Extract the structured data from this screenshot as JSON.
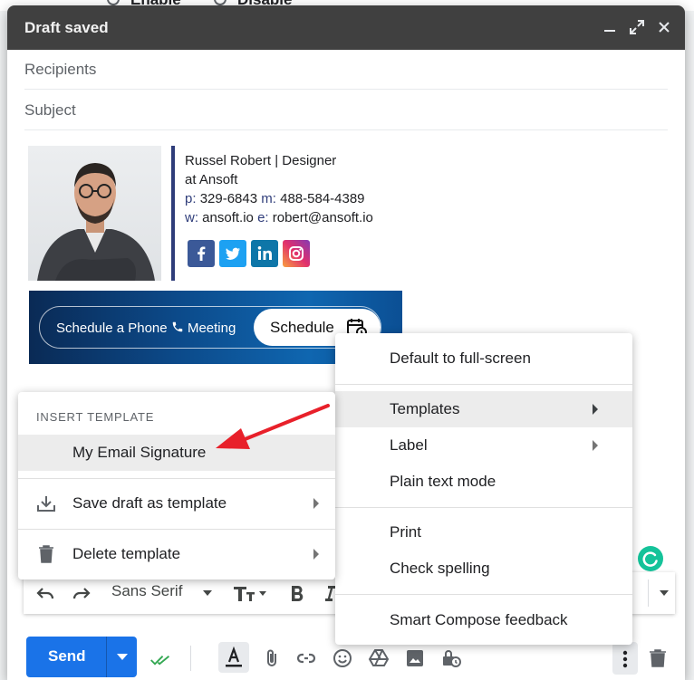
{
  "background": {
    "option_enable": "Enable",
    "option_disable": "Disable"
  },
  "compose": {
    "title": "Draft saved",
    "recipients_placeholder": "Recipients",
    "subject_placeholder": "Subject"
  },
  "signature": {
    "line1": "Russel Robert | Designer",
    "line2": "at Ansoft",
    "phone_label": "p:",
    "phone": "329-6843",
    "mobile_label": "m:",
    "mobile": "488-584-4389",
    "web_label": "w:",
    "web": "ansoft.io",
    "email_label": "e:",
    "email": "robert@ansoft.io",
    "social": [
      "facebook",
      "twitter",
      "linkedin",
      "instagram"
    ],
    "colors": {
      "accent": "#2f3d7a",
      "facebook": "#3b5998",
      "twitter": "#1da1f2",
      "linkedin": "#0e76a8"
    }
  },
  "banner": {
    "text_before": "Schedule a Phone",
    "text_after": "Meeting",
    "button_label": "Schedule"
  },
  "format_toolbar": {
    "font": "Sans Serif"
  },
  "bottom_bar": {
    "send_label": "Send",
    "accent": "#1a73e8"
  },
  "more_options_menu": {
    "items": [
      {
        "label": "Default to full-screen"
      },
      {
        "label": "Templates"
      },
      {
        "label": "Label"
      },
      {
        "label": "Plain text mode"
      },
      {
        "label": "Print"
      },
      {
        "label": "Check spelling"
      },
      {
        "label": "Smart Compose feedback"
      }
    ]
  },
  "templates_menu": {
    "heading": "INSERT TEMPLATE",
    "items": [
      {
        "label": "My Email Signature"
      },
      {
        "label": "Save draft as template"
      },
      {
        "label": "Delete template"
      }
    ]
  },
  "annotation": {
    "arrow_color": "#e8202a"
  }
}
